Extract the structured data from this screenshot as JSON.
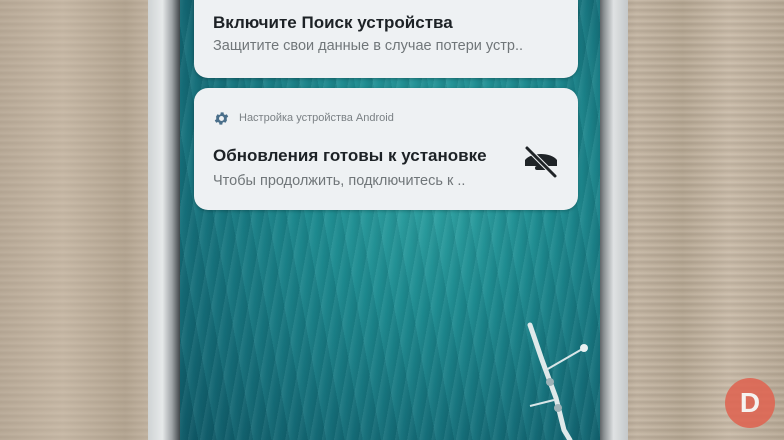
{
  "notifications": [
    {
      "title": "Включите Поиск устройства",
      "text": "Защитите свои данные в случае потери устр.."
    },
    {
      "app_icon": "gear-icon",
      "app_name": "Настройка устройства Android",
      "title": "Обновления готовы к установке",
      "text": "Чтобы продолжить, подключитесь к ..",
      "action_icon": "bell-off-icon"
    }
  ],
  "watermark": {
    "letter": "D"
  },
  "colors": {
    "card_bg": "#eef1f3",
    "water": "#1d8a8f",
    "accent_gear": "#4a6f8a",
    "watermark": "#e0624f"
  }
}
